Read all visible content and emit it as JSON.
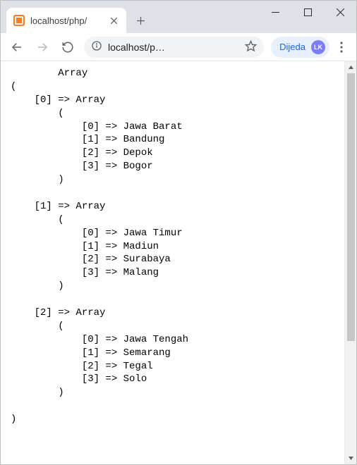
{
  "window": {
    "minimize_title": "Minimize",
    "maximize_title": "Maximize",
    "close_title": "Close"
  },
  "tab": {
    "title": "localhost/php/",
    "close_title": "Close tab",
    "new_tab_title": "New tab"
  },
  "toolbar": {
    "back_title": "Back",
    "forward_title": "Forward",
    "reload_title": "Reload",
    "site_info_title": "View site information",
    "url_display": "localhost/p…",
    "bookmark_title": "Bookmark this page",
    "profile_label": "Dijeda",
    "profile_initials": "LK",
    "menu_title": "Customize and control"
  },
  "page": {
    "array_root_label": "Array",
    "items": [
      {
        "index": 0,
        "label": "Array",
        "entries": [
          {
            "k": 0,
            "v": "Jawa Barat"
          },
          {
            "k": 1,
            "v": "Bandung"
          },
          {
            "k": 2,
            "v": "Depok"
          },
          {
            "k": 3,
            "v": "Bogor"
          }
        ]
      },
      {
        "index": 1,
        "label": "Array",
        "entries": [
          {
            "k": 0,
            "v": "Jawa Timur"
          },
          {
            "k": 1,
            "v": "Madiun"
          },
          {
            "k": 2,
            "v": "Surabaya"
          },
          {
            "k": 3,
            "v": "Malang"
          }
        ]
      },
      {
        "index": 2,
        "label": "Array",
        "entries": [
          {
            "k": 0,
            "v": "Jawa Tengah"
          },
          {
            "k": 1,
            "v": "Semarang"
          },
          {
            "k": 2,
            "v": "Tegal"
          },
          {
            "k": 3,
            "v": "Solo"
          }
        ]
      }
    ]
  }
}
